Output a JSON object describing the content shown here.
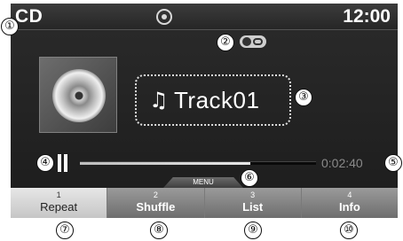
{
  "header": {
    "mode": "CD",
    "clock": "12:00"
  },
  "now_playing": {
    "track_title": "Track01",
    "elapsed": "0:02:40",
    "progress_fraction": 0.72
  },
  "menu_tab_label": "MENU",
  "softkeys": [
    {
      "number": "1",
      "label": "Repeat"
    },
    {
      "number": "2",
      "label": "Shuffle"
    },
    {
      "number": "3",
      "label": "List"
    },
    {
      "number": "4",
      "label": "Info"
    }
  ],
  "callouts": [
    "①",
    "②",
    "③",
    "④",
    "⑤",
    "⑥",
    "⑦",
    "⑧",
    "⑨",
    "⑩"
  ],
  "icons": {
    "status": "cd-disc-icon",
    "repeat_mode": "repeat-indicator-icon",
    "track": "music-note-icon",
    "playback": "pause-icon",
    "album": "album-art-disc"
  }
}
